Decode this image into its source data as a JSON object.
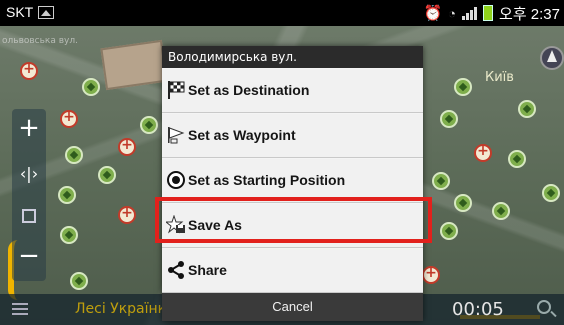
{
  "status_bar": {
    "carrier": "SKT",
    "clock": "오후 2:37",
    "icons": [
      "image-icon",
      "alarm-icon",
      "wifi-icon",
      "signal-icon",
      "battery-icon"
    ]
  },
  "map": {
    "road_label": "ольвовська вул.",
    "city_label": "Київ"
  },
  "dialog": {
    "title": "Володимирська вул.",
    "items": [
      {
        "label": "Set as Destination",
        "icon": "checkered-flag-icon"
      },
      {
        "label": "Set as Waypoint",
        "icon": "waypoint-flag-icon"
      },
      {
        "label": "Set as Starting Position",
        "icon": "location-pin-icon"
      },
      {
        "label": "Save As",
        "icon": "star-save-icon"
      },
      {
        "label": "Share",
        "icon": "share-icon"
      }
    ],
    "cancel_label": "Cancel",
    "highlighted_item": "Save As",
    "highlight_color": "#e2211c"
  },
  "bottom_bar": {
    "street_name": "Лесі Українк",
    "time": "00:05",
    "accent_color": "#f2c200"
  }
}
